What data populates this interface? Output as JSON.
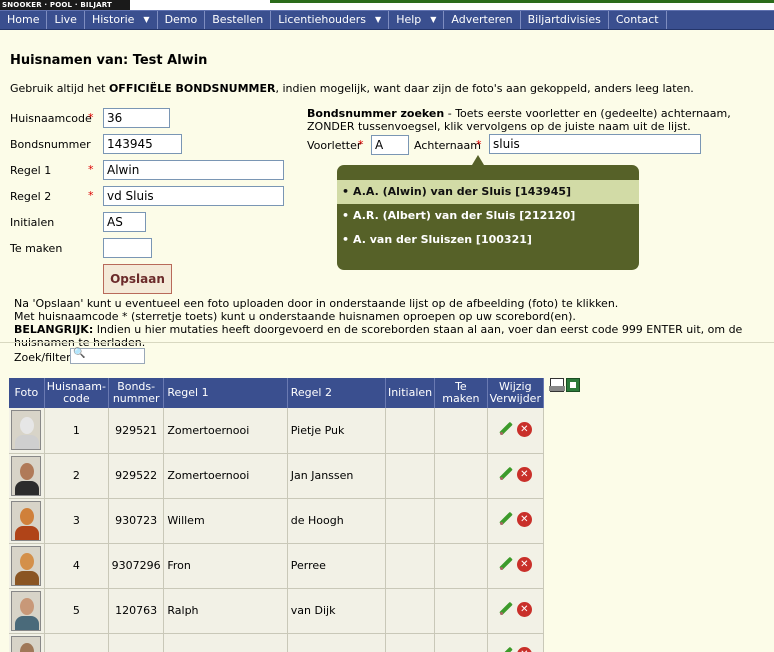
{
  "logo": {
    "text": "SNOOKER · POOL · BILJART"
  },
  "nav": [
    {
      "label": "Home",
      "caret": false
    },
    {
      "label": "Live",
      "caret": false
    },
    {
      "label": "Historie",
      "caret": true
    },
    {
      "label": "Demo",
      "caret": false
    },
    {
      "label": "Bestellen",
      "caret": false
    },
    {
      "label": "Licentiehouders",
      "caret": true
    },
    {
      "label": "Help",
      "caret": true
    },
    {
      "label": "Adverteren",
      "caret": false
    },
    {
      "label": "Biljartdivisies",
      "caret": false
    },
    {
      "label": "Contact",
      "caret": false
    }
  ],
  "page": {
    "title": "Huisnamen van: Test Alwin",
    "intro_pre": "Gebruik altijd het ",
    "intro_bold": "OFFICIËLE BONDSNUMMER",
    "intro_post": ", indien mogelijk, want daar zijn de foto's aan gekoppeld, anders leeg laten."
  },
  "form": {
    "huisnaamcode_label": "Huisnaamcode",
    "huisnaamcode_value": "36",
    "bondsnummer_label": "Bondsnummer",
    "bondsnummer_value": "143945",
    "regel1_label": "Regel 1",
    "regel1_value": "Alwin",
    "regel2_label": "Regel 2",
    "regel2_value": "vd Sluis",
    "initialen_label": "Initialen",
    "initialen_value": "AS",
    "temaken_label": "Te maken",
    "temaken_value": "",
    "required_mark": "*",
    "save_label": "Opslaan"
  },
  "search": {
    "title": "Bondsnummer zoeken",
    "instruction_line1": " - Toets eerste voorletter en (gedeelte) achternaam,",
    "instruction_line2": "ZONDER tussenvoegsel, klik vervolgens op de juiste naam uit de lijst.",
    "voorletter_label": "Voorletter",
    "voorletter_value": "A",
    "achternaam_label": "Achternaam",
    "achternaam_value": "sluis"
  },
  "autocomplete": [
    {
      "label": "A.A. (Alwin) van der Sluis [143945]",
      "selected": true
    },
    {
      "label": "A.R. (Albert) van der Sluis [212120]",
      "selected": false
    },
    {
      "label": "A. van der Sluiszen [100321]",
      "selected": false
    }
  ],
  "notes": {
    "line1": "Na 'Opslaan' kunt u eventueel een foto uploaden door in onderstaande lijst op de afbeelding (foto) te klikken.",
    "line2": "Met huisnaamcode * (sterretje toets) kunt u onderstaande huisnamen oproepen op uw scorebord(en).",
    "line3_bold": "BELANGRIJK:",
    "line3_rest": " Indien u hier mutaties heeft doorgevoerd en de scoreborden staan al aan, voer dan eerst code 999 ENTER uit, om de huisnamen te herladen."
  },
  "filter": {
    "label": "Zoek/filter:",
    "value": ""
  },
  "table": {
    "headers": {
      "foto": "Foto",
      "code1": "Huisnaam-",
      "code2": "code",
      "nummer1": "Bonds-",
      "nummer2": "nummer",
      "regel1": "Regel 1",
      "regel2": "Regel 2",
      "initialen": "Initialen",
      "temaken": "Te maken",
      "actions1": "Wijzig",
      "actions2": "Verwijder"
    },
    "rows": [
      {
        "code": "1",
        "nummer": "929521",
        "regel1": "Zomertoernooi",
        "regel2": "Pietje Puk",
        "initialen": "",
        "temaken": "",
        "skin": "#e6e6e6",
        "shirt": "#cfcfcf"
      },
      {
        "code": "2",
        "nummer": "929522",
        "regel1": "Zomertoernooi",
        "regel2": "Jan Janssen",
        "initialen": "",
        "temaken": "",
        "skin": "#b07a58",
        "shirt": "#2c2c2c"
      },
      {
        "code": "3",
        "nummer": "930723",
        "regel1": "Willem",
        "regel2": "de Hoogh",
        "initialen": "",
        "temaken": "",
        "skin": "#d0803a",
        "shirt": "#b04418"
      },
      {
        "code": "4",
        "nummer": "9307296",
        "regel1": "Fron",
        "regel2": "Perree",
        "initialen": "",
        "temaken": "",
        "skin": "#d4904a",
        "shirt": "#8a5522"
      },
      {
        "code": "5",
        "nummer": "120763",
        "regel1": "Ralph",
        "regel2": "van Dijk",
        "initialen": "",
        "temaken": "",
        "skin": "#c89878",
        "shirt": "#4a6a7a"
      },
      {
        "code": "",
        "nummer": "",
        "regel1": "",
        "regel2": "",
        "initialen": "",
        "temaken": "",
        "skin": "#a07858",
        "shirt": "#3a3a3a"
      }
    ]
  }
}
